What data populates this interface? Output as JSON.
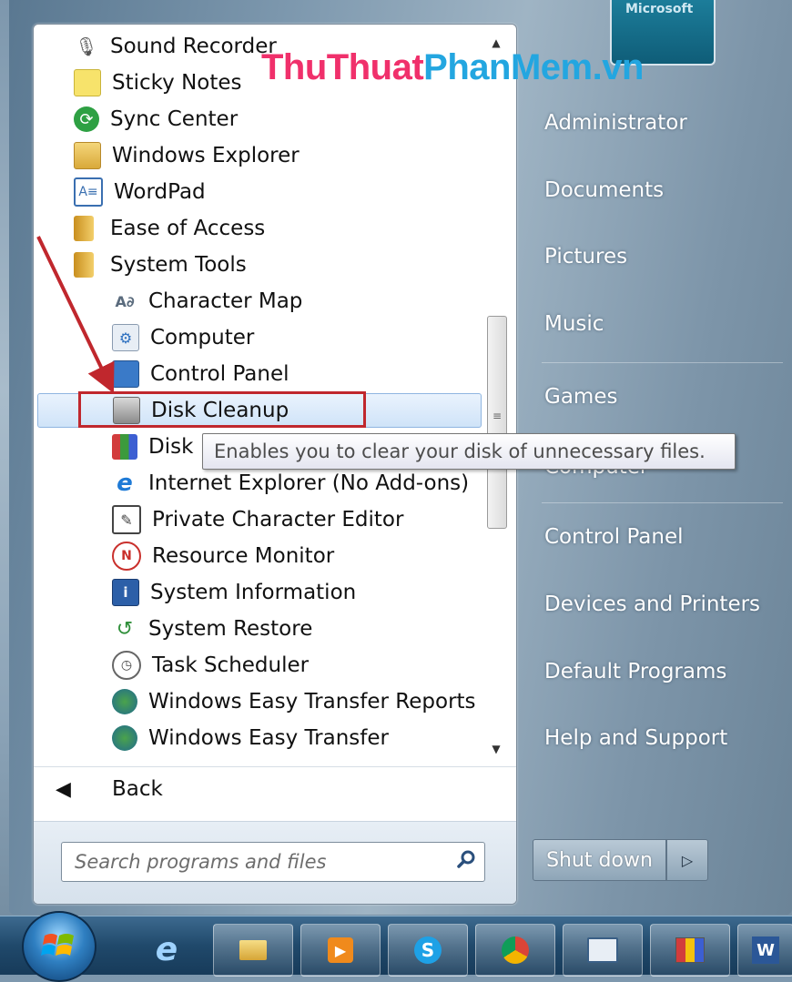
{
  "watermark": {
    "part1": "ThuThuat",
    "part2": "PhanMem.vn"
  },
  "programs": [
    {
      "label": "Sound Recorder",
      "icon": "microphone-icon"
    },
    {
      "label": "Sticky Notes",
      "icon": "sticky-notes-icon"
    },
    {
      "label": "Sync Center",
      "icon": "sync-icon"
    },
    {
      "label": "Windows Explorer",
      "icon": "explorer-folder-icon"
    },
    {
      "label": "WordPad",
      "icon": "wordpad-icon"
    },
    {
      "label": "Ease of Access",
      "icon": "folder-icon"
    },
    {
      "label": "System Tools",
      "icon": "folder-icon"
    },
    {
      "label": "Character Map",
      "icon": "character-map-icon"
    },
    {
      "label": "Computer",
      "icon": "computer-icon"
    },
    {
      "label": "Control Panel",
      "icon": "control-panel-icon"
    },
    {
      "label": "Disk Cleanup",
      "icon": "disk-cleanup-icon"
    },
    {
      "label": "Disk D",
      "icon": "disk-defrag-icon"
    },
    {
      "label": "Internet Explorer (No Add-ons)",
      "icon": "internet-explorer-icon"
    },
    {
      "label": "Private Character Editor",
      "icon": "character-editor-icon"
    },
    {
      "label": "Resource Monitor",
      "icon": "resource-monitor-icon"
    },
    {
      "label": "System Information",
      "icon": "system-information-icon"
    },
    {
      "label": "System Restore",
      "icon": "system-restore-icon"
    },
    {
      "label": "Task Scheduler",
      "icon": "clock-icon"
    },
    {
      "label": "Windows Easy Transfer Reports",
      "icon": "easy-transfer-icon"
    },
    {
      "label": "Windows Easy Transfer",
      "icon": "easy-transfer-icon"
    }
  ],
  "tooltip": "Enables you to clear your disk of unnecessary files.",
  "back_label": "Back",
  "search": {
    "placeholder": "Search programs and files"
  },
  "right_panel": {
    "user_pic_text": "Microsoft",
    "items": [
      "Administrator",
      "Documents",
      "Pictures",
      "Music",
      "Games",
      "Computer",
      "Control Panel",
      "Devices and Printers",
      "Default Programs",
      "Help and Support"
    ]
  },
  "shutdown": {
    "label": "Shut down"
  },
  "colors": {
    "highlight": "#c0272d",
    "selection": "#cfe3f8",
    "watermark_pink": "#f0306b",
    "watermark_blue": "#23a6e0"
  },
  "taskbar": {
    "items": [
      "internet-explorer-icon",
      "windows-explorer-icon",
      "media-player-icon",
      "skype-icon",
      "chrome-icon",
      "remote-desktop-icon",
      "paint-icon",
      "word-icon"
    ]
  }
}
